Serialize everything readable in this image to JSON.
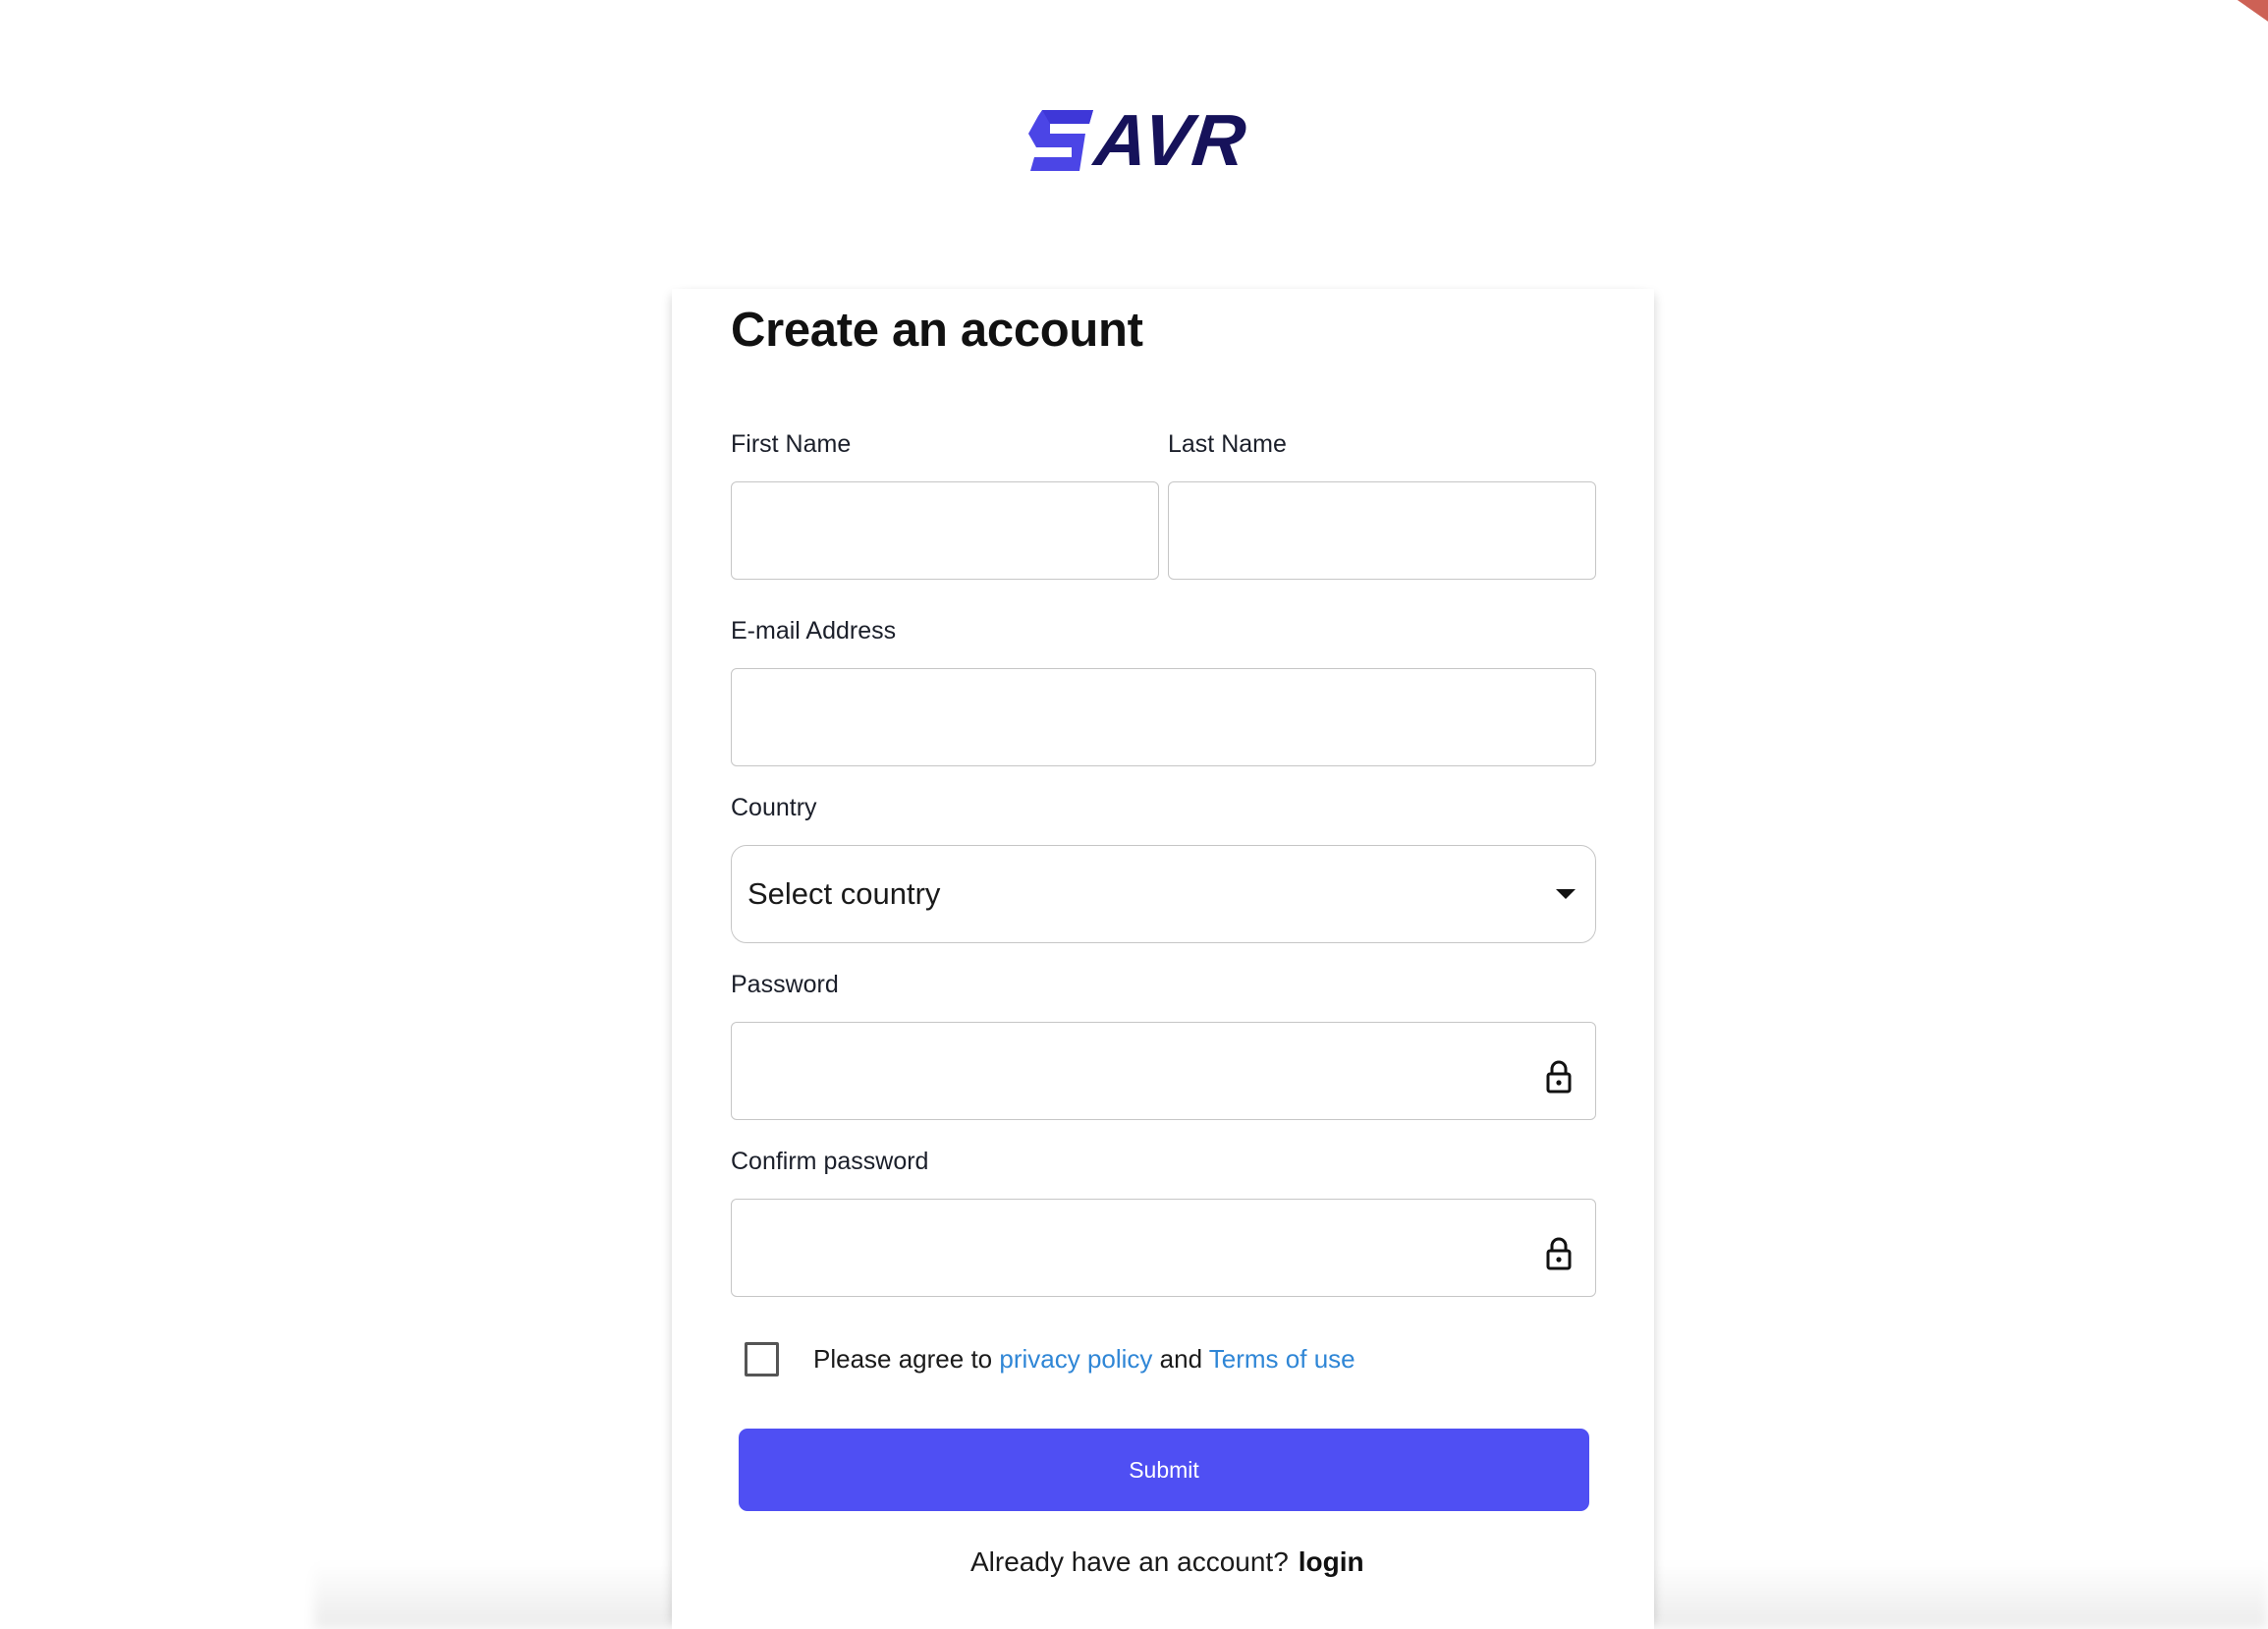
{
  "brand": {
    "name": "AVR",
    "mark_color": "#4b45e6",
    "text_color": "#16125a"
  },
  "form": {
    "title": "Create an account",
    "first_name": {
      "label": "First Name",
      "value": "",
      "placeholder": ""
    },
    "last_name": {
      "label": "Last Name",
      "value": "",
      "placeholder": ""
    },
    "email": {
      "label": "E-mail Address",
      "value": "",
      "placeholder": ""
    },
    "country": {
      "label": "Country",
      "selected": "Select country"
    },
    "password": {
      "label": "Password",
      "value": "",
      "icon": "lock-icon"
    },
    "confirm_password": {
      "label": "Confirm password",
      "value": "",
      "icon": "lock-icon"
    },
    "agree": {
      "prefix": "Please agree to ",
      "privacy_link": "privacy policy",
      "middle": " and ",
      "terms_link": "Terms of use",
      "checked": false
    },
    "submit_label": "Submit",
    "footer": {
      "prompt": "Already have an account?",
      "login_link": "login"
    }
  },
  "colors": {
    "accent": "#4f4ff3",
    "link": "#2f86d6",
    "border": "#c6c6c6"
  }
}
